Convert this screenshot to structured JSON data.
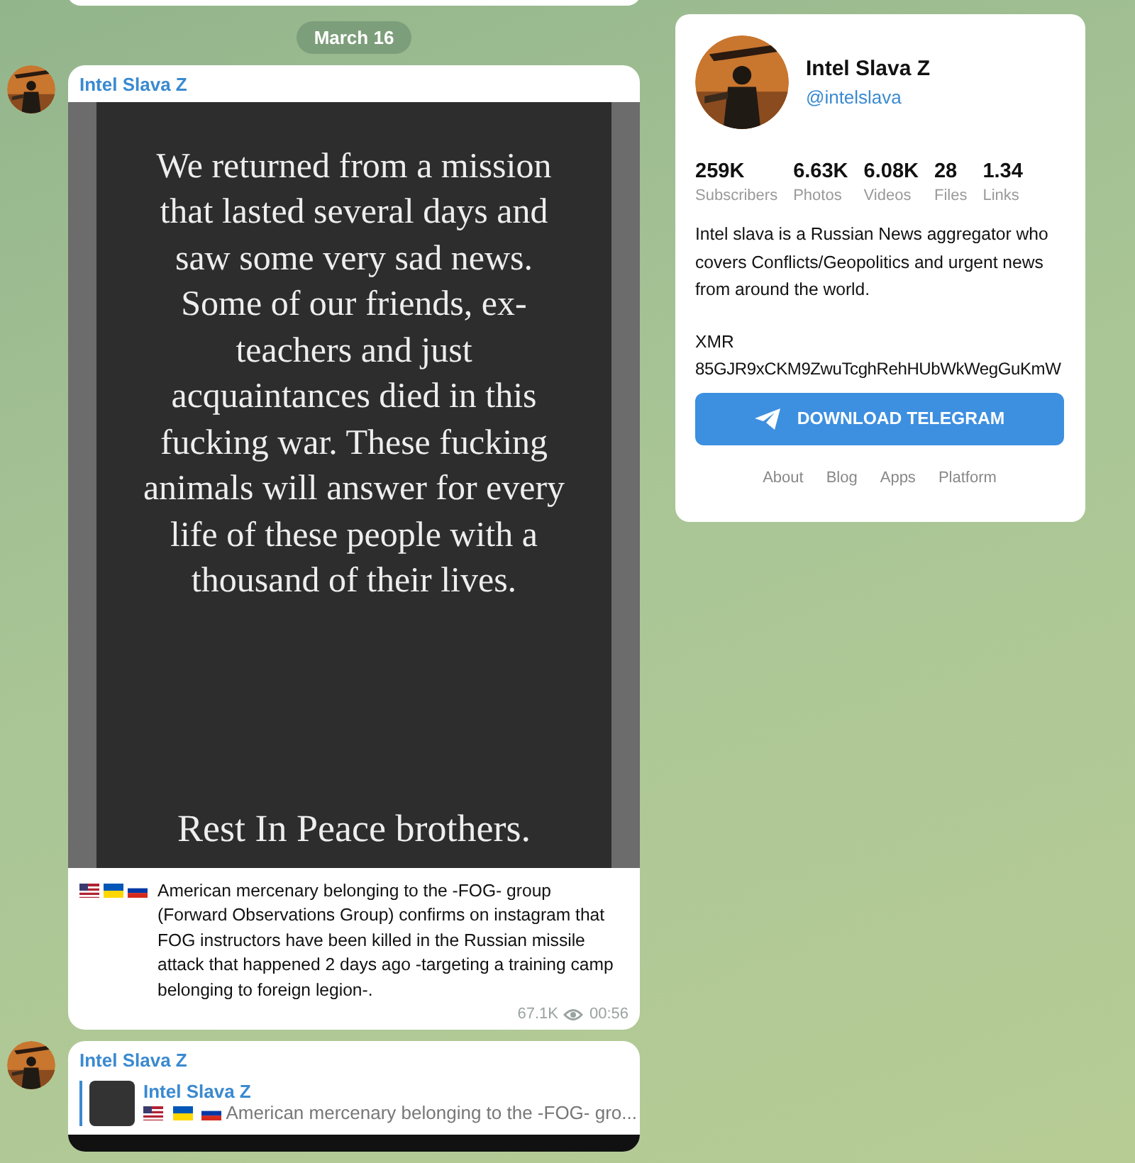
{
  "date_pill": "March 16",
  "post": {
    "channel": "Intel Slava Z",
    "image_text": "We returned from a mission that lasted several days and saw some very sad news. Some of our friends, ex-teachers and just acquaintances died in this fucking war.  These fucking animals will answer for every life of these people with a thousand of their lives.",
    "image_footer": "Rest In Peace brothers.",
    "caption": "American mercenary belonging to the -FOG- group (Forward Observations Group) confirms on instagram that FOG instructors have been killed in the Russian missile attack that happened 2 days ago -targeting a training camp belonging to foreign legion-.",
    "views": "67.1K",
    "time": "00:56"
  },
  "next_post": {
    "channel": "Intel Slava Z",
    "reply_author": "Intel Slava Z",
    "reply_text": "American mercenary belonging to the -FOG- gro..."
  },
  "profile": {
    "name": "Intel Slava Z",
    "handle": "@intelslava",
    "stats": [
      {
        "value": "259K",
        "label": "Subscribers"
      },
      {
        "value": "6.63K",
        "label": "Photos"
      },
      {
        "value": "6.08K",
        "label": "Videos"
      },
      {
        "value": "28",
        "label": "Files"
      },
      {
        "value": "1.34",
        "label": "Links"
      }
    ],
    "description": "Intel slava is a Russian News aggregator who covers Conflicts/Geopolitics and urgent news from around the world.",
    "xmr_label": "XMR",
    "xmr_address": "85GJR9xCKM9ZwuTcghRehHUbWkWegGuKmW",
    "download_button": "DOWNLOAD TELEGRAM",
    "links": [
      "About",
      "Blog",
      "Apps",
      "Platform"
    ]
  }
}
